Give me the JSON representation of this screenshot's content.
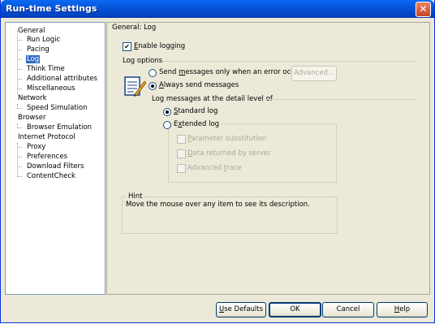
{
  "window": {
    "title": "Run-time Settings"
  },
  "tree": {
    "items": [
      {
        "label": "General"
      },
      {
        "label": "Run Logic"
      },
      {
        "label": "Pacing"
      },
      {
        "label": "Log"
      },
      {
        "label": "Think Time"
      },
      {
        "label": "Additional attributes"
      },
      {
        "label": "Miscellaneous"
      },
      {
        "label": "Network"
      },
      {
        "label": "Speed Simulation"
      },
      {
        "label": "Browser"
      },
      {
        "label": "Browser Emulation"
      },
      {
        "label": "Internet Protocol"
      },
      {
        "label": "Proxy"
      },
      {
        "label": "Preferences"
      },
      {
        "label": "Download Filters"
      },
      {
        "label": "ContentCheck"
      }
    ],
    "selected": "Log"
  },
  "panel": {
    "heading": "General: Log",
    "enable_logging": {
      "pre": "",
      "accel": "E",
      "rest": "nable logging",
      "checked": true
    },
    "log_options_label": "Log options",
    "send_on_error": {
      "pre": "Send ",
      "accel": "m",
      "rest": "essages only when an error occurs"
    },
    "advanced_button": "Advanced...",
    "always_send": {
      "pre": "",
      "accel": "A",
      "rest": "lways send messages"
    },
    "detail_label": "Log messages at the detail level of",
    "standard_log": {
      "pre": "",
      "accel": "S",
      "rest": "tandard log"
    },
    "extended_log": {
      "pre": "E",
      "accel": "x",
      "rest": "tended log"
    },
    "param_sub": {
      "pre": "",
      "accel": "P",
      "rest": "arameter substitution"
    },
    "data_returned": {
      "pre": "",
      "accel": "D",
      "rest": "ata returned by server"
    },
    "advanced_trace": {
      "pre": "Advanced ",
      "accel": "t",
      "rest": "race"
    },
    "hint": {
      "title": "Hint",
      "text": "Move the mouse over any item to see its description."
    }
  },
  "footer": {
    "use_defaults": {
      "pre": "",
      "accel": "U",
      "rest": "se Defaults"
    },
    "ok": "OK",
    "cancel": "Cancel",
    "help": {
      "pre": "",
      "accel": "H",
      "rest": "elp"
    }
  }
}
